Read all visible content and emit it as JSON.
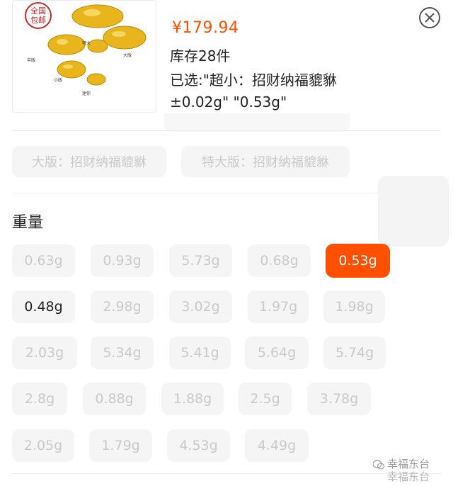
{
  "header": {
    "stamp_text": [
      "全国",
      "包邮"
    ],
    "product_labels": [
      "特大",
      "大版",
      "中版",
      "小版",
      "迷你"
    ],
    "price": "¥179.94",
    "stock": "库存28件",
    "selected_line1": "已选:\"超小：招财纳福貔貅",
    "selected_line2": "±0.02g\" \"0.53g\""
  },
  "sizes": {
    "options": [
      "大版：招财纳福貔貅",
      "特大版：招财纳福貔貅"
    ]
  },
  "weight": {
    "title": "重量",
    "options": [
      [
        "0.63g",
        "0.93g",
        "5.73g",
        "0.68g",
        "0.53g"
      ],
      [
        "0.48g",
        "2.98g",
        "3.02g",
        "1.97g",
        "1.98g"
      ],
      [
        "2.03g",
        "5.34g",
        "5.41g",
        "5.64g",
        "5.74g"
      ],
      [
        "2.8g",
        "0.88g",
        "1.88g",
        "2.5g",
        "3.78g"
      ],
      [
        "2.05g",
        "1.79g",
        "4.53g",
        "4.49g"
      ]
    ],
    "selected": "0.53g",
    "available": [
      "0.48g"
    ]
  },
  "watermark": {
    "line1": "幸福东台",
    "line2": "幸福东台"
  },
  "colors": {
    "accent": "#ff5000",
    "chip_bg": "#f5f5f5",
    "chip_disabled_text": "#c9c9c9"
  }
}
